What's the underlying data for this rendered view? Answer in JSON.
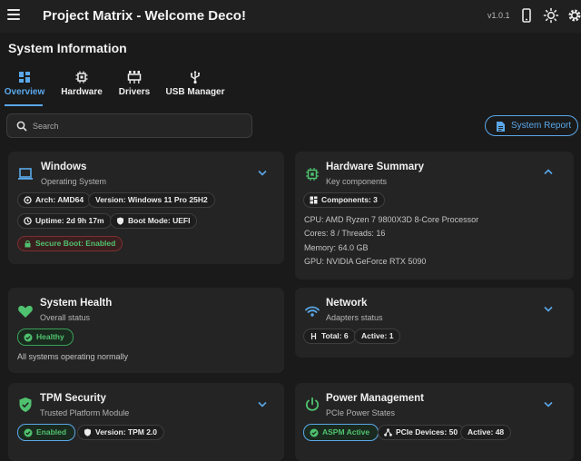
{
  "app": {
    "title": "Project Matrix - Welcome Deco!",
    "version": "v1.0.1",
    "icons": [
      "menu-icon",
      "mobile-icon",
      "brightness-icon",
      "gear-icon"
    ]
  },
  "page": {
    "title": "System Information"
  },
  "tabs": [
    {
      "label": "Overview",
      "icon": "grid-icon",
      "active": true
    },
    {
      "label": "Hardware",
      "icon": "chip-icon",
      "active": false
    },
    {
      "label": "Drivers",
      "icon": "driver-icon",
      "active": false
    },
    {
      "label": "USB Manager",
      "icon": "usb-icon",
      "active": false
    }
  ],
  "search": {
    "placeholder": "Search",
    "value": ""
  },
  "report_button": {
    "label": "System Report"
  },
  "colors": {
    "accent": "#5aa8ea",
    "success": "#4fc26f",
    "danger_bg": "#3a1f1f"
  },
  "cards": {
    "windows": {
      "title": "Windows",
      "subtitle": "Operating System",
      "chips": {
        "arch": "Arch: AMD64",
        "version": "Version: Windows 11 Pro 25H2",
        "uptime": "Uptime: 2d 9h 17m",
        "boot": "Boot Mode: UEFI",
        "secure": "Secure Boot: Enabled"
      }
    },
    "hardware": {
      "title": "Hardware Summary",
      "subtitle": "Key components",
      "chip": "Components: 3",
      "lines": [
        "CPU: AMD Ryzen 7 9800X3D 8-Core Processor",
        "Cores: 8 / Threads: 16",
        "Memory: 64.0 GB",
        "GPU: NVIDIA GeForce RTX 5090"
      ]
    },
    "health": {
      "title": "System Health",
      "subtitle": "Overall status",
      "chip": "Healthy",
      "message": "All systems operating normally"
    },
    "network": {
      "title": "Network",
      "subtitle": "Adapters status",
      "chips": {
        "total": "Total: 6",
        "active": "Active: 1"
      }
    },
    "tpm": {
      "title": "TPM Security",
      "subtitle": "Trusted Platform Module",
      "chips": {
        "enabled": "Enabled",
        "version": "Version: TPM 2.0"
      }
    },
    "power": {
      "title": "Power Management",
      "subtitle": "PCIe Power States",
      "chips": {
        "aspm": "ASPM Active",
        "devices": "PCIe Devices: 50",
        "active": "Active: 48"
      }
    }
  }
}
